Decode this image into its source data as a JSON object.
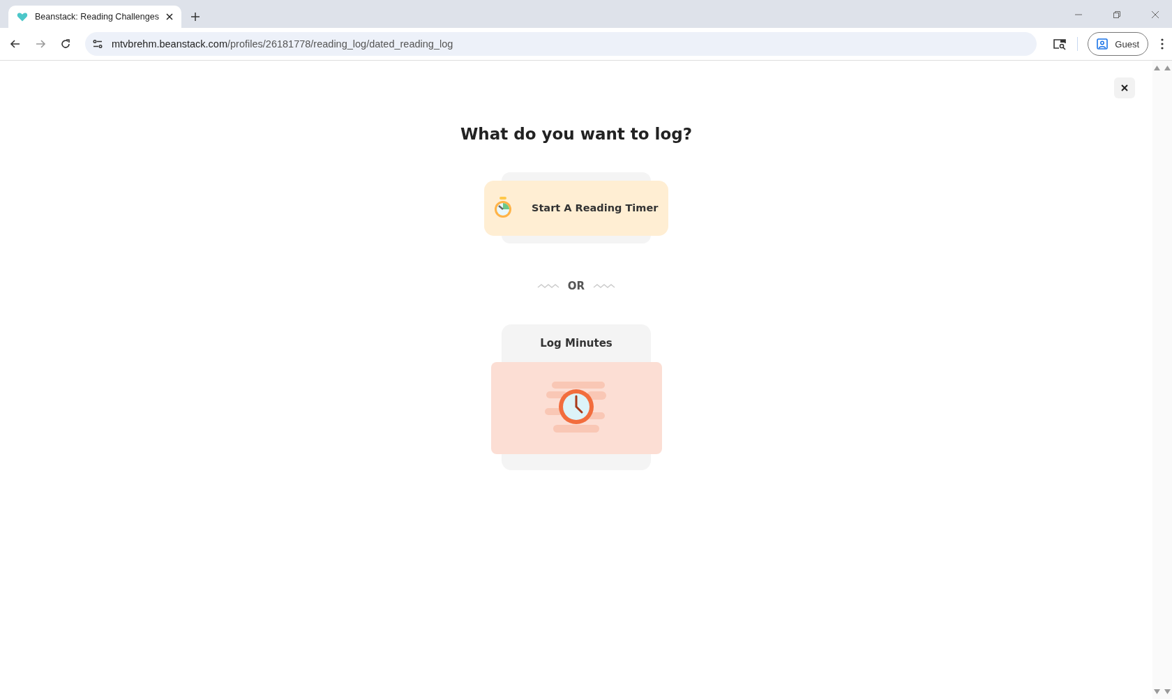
{
  "browser": {
    "tabs": [
      {
        "title": "Beanstack: Reading Challenges",
        "selected": true
      }
    ],
    "url": {
      "host": "mtvbrehm.beanstack.com",
      "path": "/profiles/26181778/reading_log/dated_reading_log"
    },
    "profile": "Guest"
  },
  "dialog": {
    "heading": "What do you want to log?",
    "options": [
      {
        "kind": "timer",
        "label": "Start A Reading Timer"
      },
      {
        "kind": "divider",
        "label": "OR"
      },
      {
        "kind": "minutes",
        "label": "Log Minutes"
      }
    ]
  }
}
